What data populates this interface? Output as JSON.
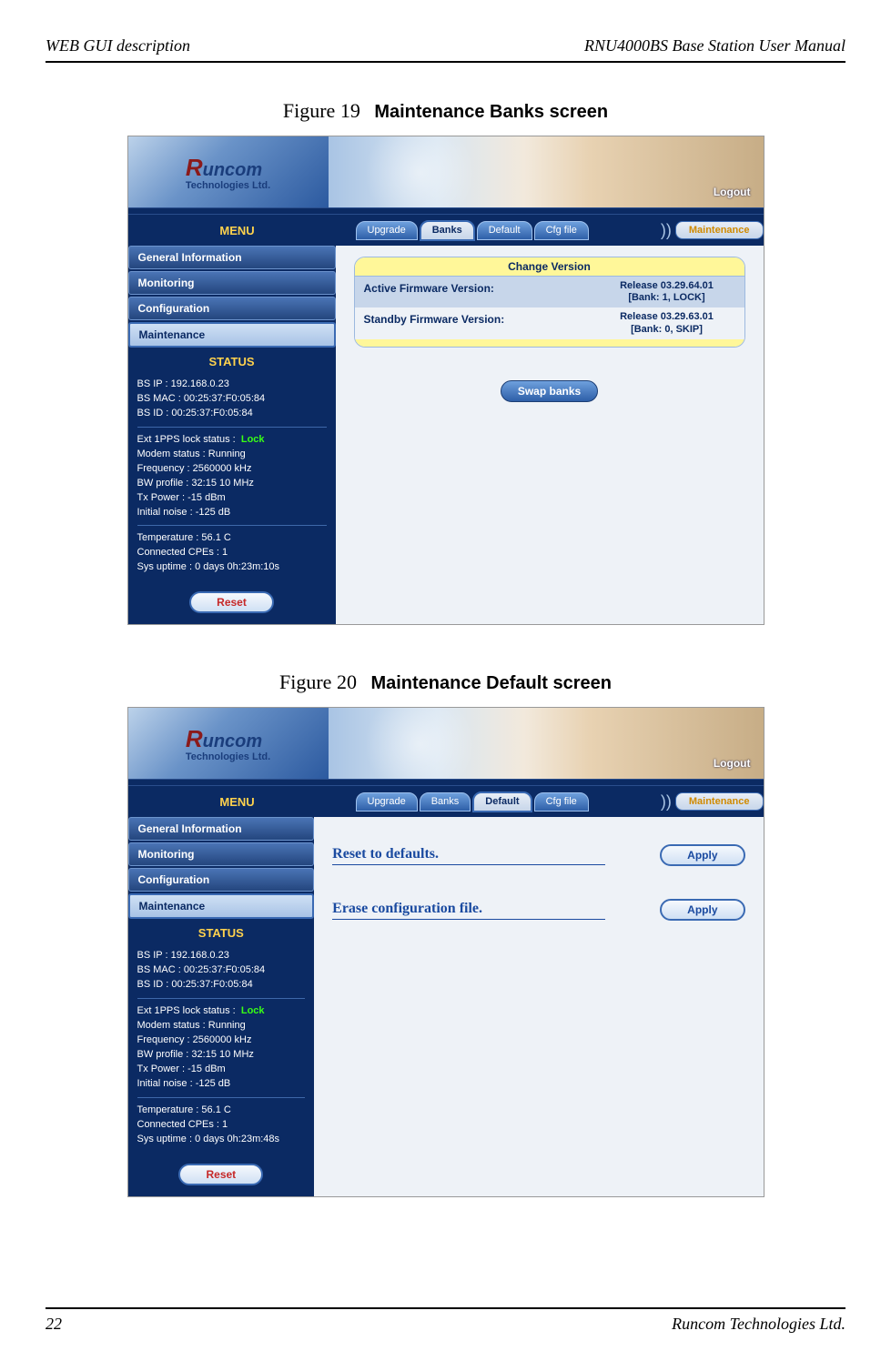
{
  "doc": {
    "header_left": "WEB GUI description",
    "header_right": "RNU4000BS Base Station User Manual",
    "footer_left": "22",
    "footer_right": "Runcom Technologies Ltd."
  },
  "figures": {
    "f19": {
      "num": "Figure 19",
      "title": "Maintenance Banks screen"
    },
    "f20": {
      "num": "Figure 20",
      "title": "Maintenance Default screen"
    }
  },
  "common": {
    "logo_big": "R",
    "logo_rest": "uncom",
    "logo_sub": "Technologies Ltd.",
    "logout": "Logout",
    "menu_label": "MENU",
    "tabs": {
      "upgrade": "Upgrade",
      "banks": "Banks",
      "default": "Default",
      "cfg": "Cfg file"
    },
    "crumb": "Maintenance",
    "sidebar": {
      "general": "General Information",
      "monitoring": "Monitoring",
      "config": "Configuration",
      "maint": "Maintenance"
    },
    "status_label": "STATUS",
    "reset_label": "Reset"
  },
  "status_a": {
    "bs_ip": "BS IP :  192.168.0.23",
    "bs_mac": "BS MAC :  00:25:37:F0:05:84",
    "bs_id": "BS ID :  00:25:37:F0:05:84",
    "pps_label": "Ext 1PPS lock status :",
    "pps_val": "Lock",
    "modem": "Modem status :  Running",
    "freq": "Frequency :  2560000 kHz",
    "bw": "BW profile :  32:15 10 MHz",
    "tx": "Tx Power :  -15 dBm",
    "noise": "Initial noise :  -125 dB",
    "temp": "Temperature :  56.1 C",
    "cpes": "Connected CPEs :  1",
    "uptime": "Sys uptime :  0 days 0h:23m:10s"
  },
  "status_b": {
    "bs_ip": "BS IP :  192.168.0.23",
    "bs_mac": "BS MAC :  00:25:37:F0:05:84",
    "bs_id": "BS ID :  00:25:37:F0:05:84",
    "pps_label": "Ext 1PPS lock status :",
    "pps_val": "Lock",
    "modem": "Modem status :  Running",
    "freq": "Frequency :  2560000 kHz",
    "bw": "BW profile :  32:15 10 MHz",
    "tx": "Tx Power :  -15 dBm",
    "noise": "Initial noise :  -125 dB",
    "temp": "Temperature :  56.1 C",
    "cpes": "Connected CPEs :  1",
    "uptime": "Sys uptime :  0 days 0h:23m:48s"
  },
  "banks_panel": {
    "title": "Change Version",
    "active_label": "Active Firmware Version:",
    "active_val_line1": "Release 03.29.64.01",
    "active_val_line2": "[Bank: 1, LOCK]",
    "standby_label": "Standby Firmware Version:",
    "standby_val_line1": "Release 03.29.63.01",
    "standby_val_line2": "[Bank: 0, SKIP]",
    "swap_label": "Swap banks"
  },
  "default_panel": {
    "reset_label": "Reset to defaults.",
    "erase_label": "Erase configuration file.",
    "apply_label": "Apply"
  }
}
